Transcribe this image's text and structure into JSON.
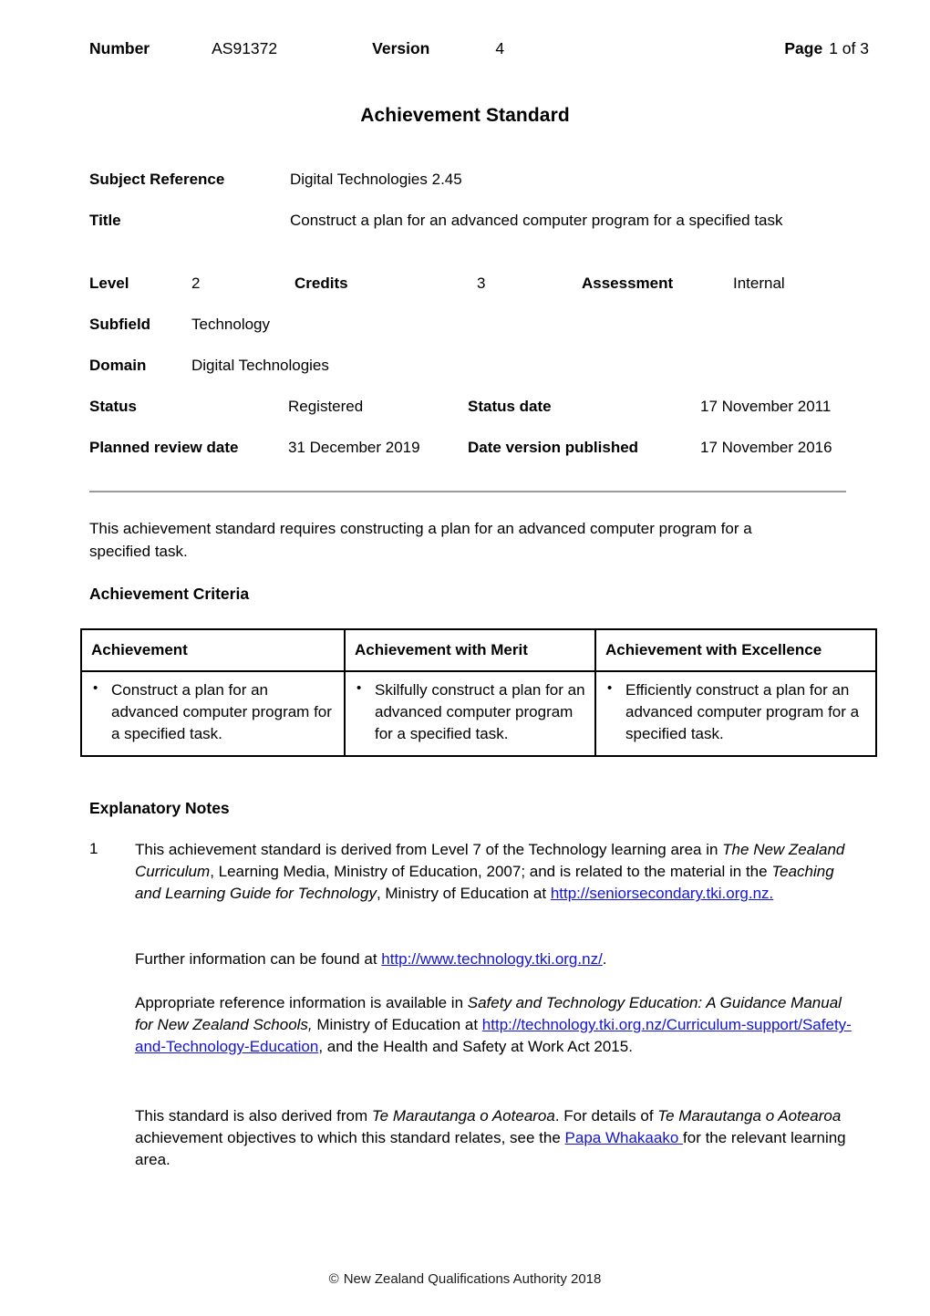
{
  "header": {
    "number_label": "Number",
    "number_value": "AS91372",
    "version_label": "Version",
    "version_value": "4",
    "page_label": "Page",
    "page_value": "1 of 3"
  },
  "title": "Achievement Standard",
  "meta": {
    "subject_reference_label": "Subject Reference",
    "subject_reference_value": "Digital Technologies 2.45",
    "title_label": "Title",
    "title_value": "Construct a plan for an advanced computer program for a specified task",
    "level_label": "Level",
    "level_value": "2",
    "credits_label": "Credits",
    "credits_value": "3",
    "assessment_label": "Assessment",
    "assessment_value": "Internal",
    "subfield_label": "Subfield",
    "subfield_value": "Technology",
    "domain_label": "Domain",
    "domain_value": "Digital Technologies",
    "status_label": "Status",
    "status_value": "Registered",
    "status_date_label": "Status date",
    "status_date_value": "17 November 2011",
    "planned_review_label": "Planned review date",
    "planned_review_value": "31 December 2019",
    "date_published_label": "Date version published",
    "date_published_value": "17 November 2016"
  },
  "intro": "This achievement standard requires constructing a plan for an advanced computer program for a specified task.",
  "achievement_criteria": {
    "heading": "Achievement Criteria",
    "columns": [
      "Achievement",
      "Achievement with Merit",
      "Achievement with Excellence"
    ],
    "rows": [
      {
        "achievement": "Construct a plan for an advanced computer program for a specified task.",
        "merit": "Skilfully construct a plan for an advanced computer program for a specified task.",
        "excellence": "Efficiently construct a plan for an advanced computer program for a specified task."
      }
    ],
    "bullet_glyph": "•"
  },
  "explanatory_notes": {
    "heading": "Explanatory Notes",
    "note1": {
      "number": "1",
      "p1_part1": "This achievement standard is derived from Level 7 of the Technology learning area in ",
      "p1_italic1": "The New Zealand Curriculum",
      "p1_part2": ", Learning Media, Ministry of Education, 2007; and is related to the material in the ",
      "p1_italic2": "Teaching and Learning Guide for Technology",
      "p1_part3": ", Ministry of Education at ",
      "p1_link": "http://seniorsecondary.tki.org.nz.",
      "p2_part1": "Further information can be found at ",
      "p2_link": "http://www.technology.tki.org.nz/",
      "p2_part2": ".",
      "p3_part1": "Appropriate reference information is available in ",
      "p3_italic1": "Safety and Technology Education: A Guidance Manual for New Zealand Schools,",
      "p3_part2": " Ministry of Education at ",
      "p3_link": "http://technology.tki.org.nz/Curriculum-support/Safety-and-Technology-Education",
      "p3_part3": ", and the Health and Safety at Work Act 2015.",
      "p4_part1": "This standard is also derived from ",
      "p4_italic1": "Te Marautanga o Aotearoa",
      "p4_part2": ".  For details of ",
      "p4_italic2": "Te Marautanga o Aotearoa",
      "p4_part3": " achievement objectives to which this standard relates, see the ",
      "p4_link": "Papa Whakaako ",
      "p4_part4": "for the relevant learning area."
    }
  },
  "footer": {
    "copyright_symbol": "©",
    "text": "New Zealand Qualifications Authority 2018"
  },
  "colors": {
    "link": "#1414d6",
    "divider": "#9a9a9a",
    "text": "#000000"
  }
}
